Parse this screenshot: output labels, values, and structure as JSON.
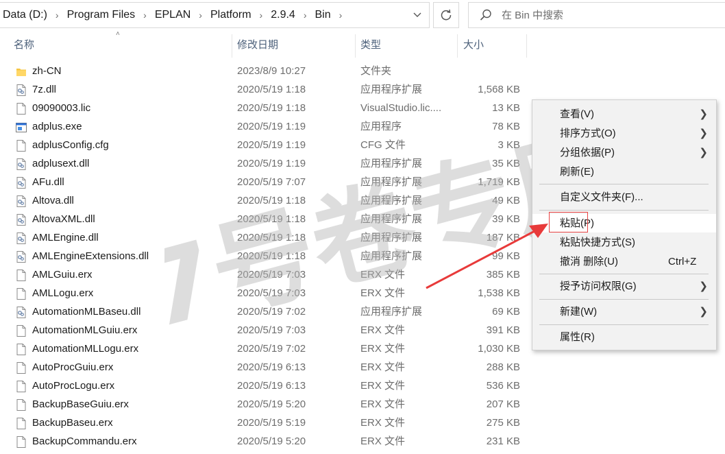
{
  "address": {
    "crumbs": [
      "Data (D:)",
      "Program Files",
      "EPLAN",
      "Platform",
      "2.9.4",
      "Bin"
    ],
    "dropdown_icon": "chevron-down-icon",
    "refresh_icon": "refresh-icon"
  },
  "search": {
    "placeholder": "在 Bin 中搜索",
    "icon": "search-icon"
  },
  "columns": {
    "name": "名称",
    "date": "修改日期",
    "type": "类型",
    "size": "大小"
  },
  "files": [
    {
      "name": "zh-CN",
      "date": "2023/8/9 10:27",
      "type": "文件夹",
      "size": "",
      "icon": "folder"
    },
    {
      "name": "7z.dll",
      "date": "2020/5/19 1:18",
      "type": "应用程序扩展",
      "size": "1,568 KB",
      "icon": "dll"
    },
    {
      "name": "09090003.lic",
      "date": "2020/5/19 1:18",
      "type": "VisualStudio.lic....",
      "size": "13 KB",
      "icon": "file"
    },
    {
      "name": "adplus.exe",
      "date": "2020/5/19 1:19",
      "type": "应用程序",
      "size": "78 KB",
      "icon": "exe"
    },
    {
      "name": "adplusConfig.cfg",
      "date": "2020/5/19 1:19",
      "type": "CFG 文件",
      "size": "3 KB",
      "icon": "file"
    },
    {
      "name": "adplusext.dll",
      "date": "2020/5/19 1:19",
      "type": "应用程序扩展",
      "size": "35 KB",
      "icon": "dll"
    },
    {
      "name": "AFu.dll",
      "date": "2020/5/19 7:07",
      "type": "应用程序扩展",
      "size": "1,719 KB",
      "icon": "dll"
    },
    {
      "name": "Altova.dll",
      "date": "2020/5/19 1:18",
      "type": "应用程序扩展",
      "size": "49 KB",
      "icon": "dll"
    },
    {
      "name": "AltovaXML.dll",
      "date": "2020/5/19 1:18",
      "type": "应用程序扩展",
      "size": "39 KB",
      "icon": "dll"
    },
    {
      "name": "AMLEngine.dll",
      "date": "2020/5/19 1:18",
      "type": "应用程序扩展",
      "size": "187 KB",
      "icon": "dll"
    },
    {
      "name": "AMLEngineExtensions.dll",
      "date": "2020/5/19 1:18",
      "type": "应用程序扩展",
      "size": "99 KB",
      "icon": "dll"
    },
    {
      "name": "AMLGuiu.erx",
      "date": "2020/5/19 7:03",
      "type": "ERX 文件",
      "size": "385 KB",
      "icon": "file"
    },
    {
      "name": "AMLLogu.erx",
      "date": "2020/5/19 7:03",
      "type": "ERX 文件",
      "size": "1,538 KB",
      "icon": "file"
    },
    {
      "name": "AutomationMLBaseu.dll",
      "date": "2020/5/19 7:02",
      "type": "应用程序扩展",
      "size": "69 KB",
      "icon": "dll"
    },
    {
      "name": "AutomationMLGuiu.erx",
      "date": "2020/5/19 7:03",
      "type": "ERX 文件",
      "size": "391 KB",
      "icon": "file"
    },
    {
      "name": "AutomationMLLogu.erx",
      "date": "2020/5/19 7:02",
      "type": "ERX 文件",
      "size": "1,030 KB",
      "icon": "file"
    },
    {
      "name": "AutoProcGuiu.erx",
      "date": "2020/5/19 6:13",
      "type": "ERX 文件",
      "size": "288 KB",
      "icon": "file"
    },
    {
      "name": "AutoProcLogu.erx",
      "date": "2020/5/19 6:13",
      "type": "ERX 文件",
      "size": "536 KB",
      "icon": "file"
    },
    {
      "name": "BackupBaseGuiu.erx",
      "date": "2020/5/19 5:20",
      "type": "ERX 文件",
      "size": "207 KB",
      "icon": "file"
    },
    {
      "name": "BackupBaseu.erx",
      "date": "2020/5/19 5:19",
      "type": "ERX 文件",
      "size": "275 KB",
      "icon": "file"
    },
    {
      "name": "BackupCommandu.erx",
      "date": "2020/5/19 5:20",
      "type": "ERX 文件",
      "size": "231 KB",
      "icon": "file"
    }
  ],
  "context_menu": {
    "view": "查看(V)",
    "sort": "排序方式(O)",
    "group": "分组依据(P)",
    "refresh": "刷新(E)",
    "customize": "自定义文件夹(F)...",
    "paste": "粘贴(P)",
    "paste_shortcut": "粘贴快捷方式(S)",
    "undo_delete": "撤消 删除(U)",
    "undo_shortcut": "Ctrl+Z",
    "grant_access": "授予访问权限(G)",
    "new": "新建(W)",
    "properties": "属性(R)"
  },
  "watermark": {
    "text": "7号卷专用",
    "color": "#b3b3b3"
  },
  "annotation": {
    "arrow_color": "#e83a3a"
  }
}
